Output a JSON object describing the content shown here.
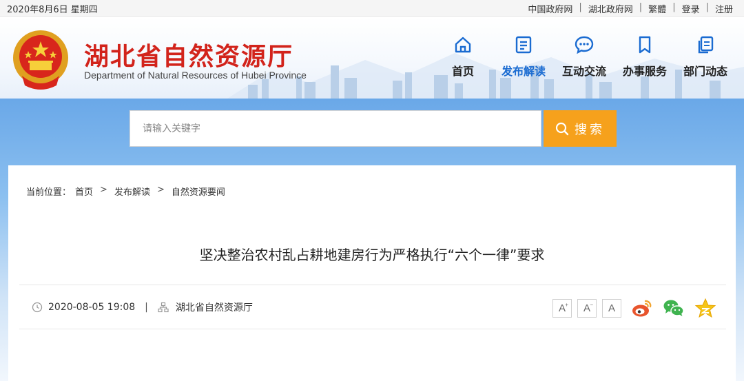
{
  "topbar": {
    "date": "2020年8月6日 星期四",
    "links": [
      "中国政府网",
      "湖北政府网",
      "繁體",
      "登录",
      "注册"
    ]
  },
  "header": {
    "title": "湖北省自然资源厅",
    "subtitle": "Department of Natural Resources of Hubei Province"
  },
  "nav": [
    {
      "label": "首页",
      "icon": "home-icon"
    },
    {
      "label": "发布解读",
      "icon": "document-list-icon"
    },
    {
      "label": "互动交流",
      "icon": "chat-bubble-icon"
    },
    {
      "label": "办事服务",
      "icon": "bookmark-icon"
    },
    {
      "label": "部门动态",
      "icon": "copy-document-icon"
    }
  ],
  "nav_active": "发布解读",
  "search": {
    "placeholder": "请输入关键字",
    "button_label": "搜索"
  },
  "breadcrumb": {
    "prefix": "当前位置：",
    "items": [
      "首页",
      "发布解读",
      "自然资源要闻"
    ],
    "separator": ">"
  },
  "article": {
    "title": "坚决整治农村乱占耕地建房行为严格执行“六个一律”要求",
    "datetime": "2020-08-05 19:08",
    "source": "湖北省自然资源厅",
    "meta_separator": "|"
  },
  "font_tools": [
    "A",
    "A",
    "A"
  ],
  "share": [
    "weibo-icon",
    "wechat-icon",
    "star-favorite-icon"
  ],
  "colors": {
    "brand_red": "#d2231b",
    "nav_active": "#1a6bd1",
    "search_button": "#f6a11c",
    "band_blue": "#6aa8e8"
  }
}
